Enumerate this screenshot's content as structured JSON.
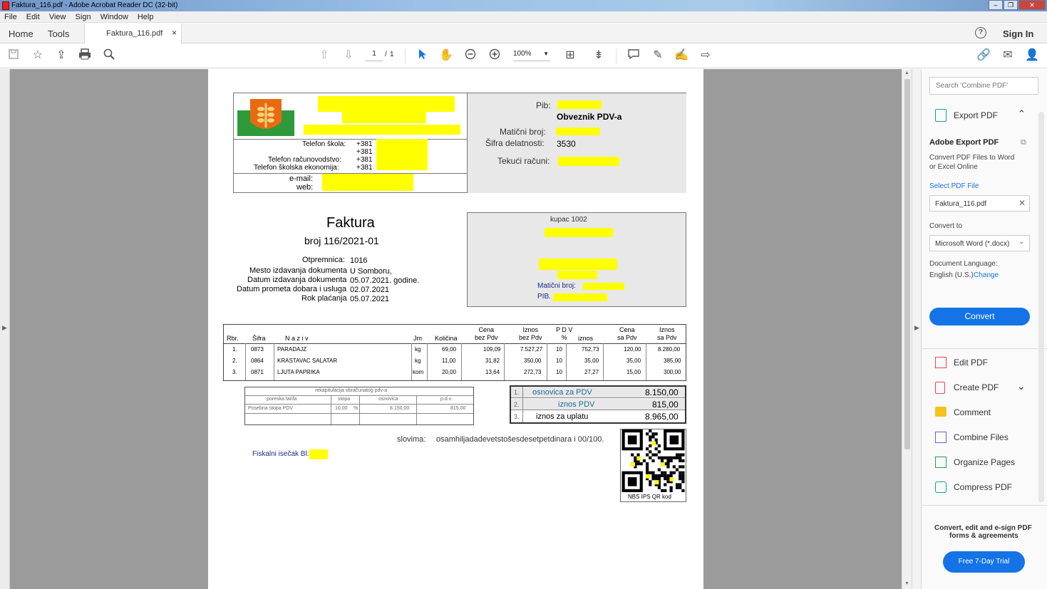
{
  "window": {
    "title": "Faktura_116.pdf - Adobe Acrobat Reader DC (32-bit)"
  },
  "menu": [
    "File",
    "Edit",
    "View",
    "Sign",
    "Window",
    "Help"
  ],
  "tabs": {
    "home": "Home",
    "tools": "Tools",
    "document": "Faktura_116.pdf",
    "close": "×"
  },
  "header": {
    "help_icon": "?",
    "sign_in": "Sign In"
  },
  "toolbar": {
    "page_current": "1",
    "page_sep": "/",
    "page_total": "1",
    "zoom": "100%"
  },
  "doc": {
    "phone_school_label": "Telefon škola:",
    "phone_prefix": "+381",
    "phone_acct_label": "Telefon računovodstvo:",
    "phone_econ_label": "Telefon školska ekonomija:",
    "email_label": "e-mail:",
    "web_label": "web:",
    "pib_label": "Pib:",
    "vat_payer": "Obveznik PDV-a",
    "reg_label": "Matični broj:",
    "activity_label": "Šifra delatnosti:",
    "activity_code": "3530",
    "accounts_label": "Tekući računi:",
    "invoice_title": "Faktura",
    "invoice_number": "broj  116/2021-01",
    "delivery_label": "Otpremnica:",
    "delivery_value": "1016",
    "place_label": "Mesto izdavanja dokumenta",
    "place_value": "U Somboru,",
    "date_issue_label": "Datum izdavanja dokumenta",
    "date_issue_value": "05.07.2021. godine.",
    "date_trade_label": "Datum prometa dobara i usluga",
    "date_trade_value": "02.07.2021",
    "due_label": "Rok plaćanja",
    "due_value": "05.07.2021",
    "buyer_label": "kupac 1002",
    "buyer_reg_label": "Matični broj:",
    "buyer_pib_label": "PIB.",
    "table_headers": [
      "Rbr.",
      "Šifra",
      "N a z i v",
      "Jm",
      "Količina",
      "Cena\nbez Pdv",
      "Iznos\nbez Pdv",
      "P D V\n%",
      "iznos",
      "Cena\nsa Pdv",
      "Iznos\nsa Pdv"
    ],
    "items": [
      {
        "rbr": "1.",
        "code": "0873",
        "name": "PARADAJZ",
        "unit": "kg",
        "qty": "69,00",
        "price": "109,09",
        "amount": "7.527,27",
        "vat_pct": "10",
        "vat_amt": "752,73",
        "price_vat": "120,00",
        "total": "8.280,00"
      },
      {
        "rbr": "2.",
        "code": "0864",
        "name": "KRASTAVAC SALATAR",
        "unit": "kg",
        "qty": "11,00",
        "price": "31,82",
        "amount": "350,00",
        "vat_pct": "10",
        "vat_amt": "35,00",
        "price_vat": "35,00",
        "total": "385,00"
      },
      {
        "rbr": "3.",
        "code": "0871",
        "name": "LJUTA PAPRIKA",
        "unit": "kom",
        "qty": "20,00",
        "price": "13,64",
        "amount": "272,73",
        "vat_pct": "10",
        "vat_amt": "27,27",
        "price_vat": "15,00",
        "total": "300,00"
      }
    ],
    "recap_title": "rekapitulacija obračunatog pdv-a",
    "recap_headers": [
      "poreska tarifa",
      "stopa",
      "osnovica",
      "p.d.v."
    ],
    "recap_row": {
      "tariff": "Posebna stopa PDV",
      "rate": "10,00",
      "pct": "%",
      "base": "8.150,00",
      "vat": "815,00"
    },
    "totals": [
      {
        "n": "1.",
        "label": "osnovica za PDV",
        "value": "8.150,00"
      },
      {
        "n": "2.",
        "label": "iznos PDV",
        "value": "815,00"
      },
      {
        "n": "3.",
        "label": "iznos za uplatu",
        "value": "8.965,00"
      }
    ],
    "words_label": "slovima:",
    "words_value": "osamhiljadadevetstošesdesetpetdinara i  00/100.",
    "fiscal_label": "Fiskalni isečak Bl:",
    "qr_caption": "NBS IPS QR kod"
  },
  "panel": {
    "search_placeholder": "Search 'Combine PDF'",
    "export_header": "Export PDF",
    "adobe_export_title": "Adobe Export PDF",
    "adobe_export_desc1": "Convert PDF Files to Word",
    "adobe_export_desc2": "or Excel Online",
    "select_file_label": "Select PDF File",
    "file_name": "Faktura_116.pdf",
    "convert_to_label": "Convert to",
    "convert_to_value": "Microsoft Word (*.docx)",
    "doc_lang_label": "Document Language:",
    "doc_lang_value": "English (U.S.)",
    "change_link": "Change",
    "convert_button": "Convert",
    "tools": [
      "Edit PDF",
      "Create PDF",
      "Comment",
      "Combine Files",
      "Organize Pages",
      "Compress PDF"
    ],
    "promo1": "Convert, edit and e-sign PDF",
    "promo2": "forms & agreements",
    "trial_button": "Free 7-Day Trial"
  },
  "colors": {
    "accent": "#1473e6",
    "highlight": "#ffff00",
    "viewer_bg": "#9b9b9b"
  }
}
